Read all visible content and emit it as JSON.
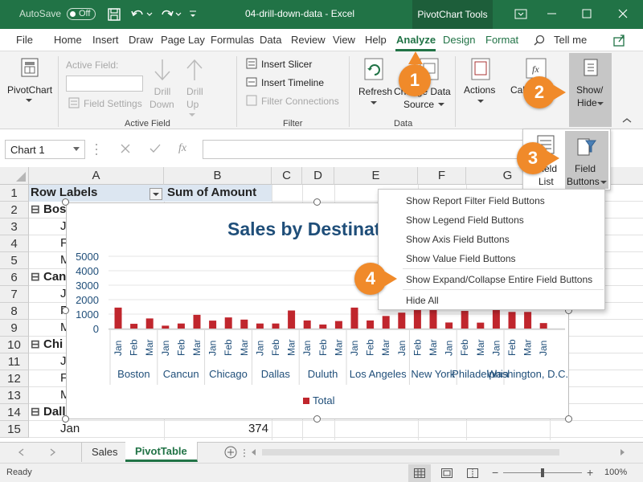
{
  "title_bar": {
    "autosave": "AutoSave",
    "autosave_state": "Off",
    "document_title": "04-drill-down-data  -  Excel",
    "context_tab": "PivotChart Tools"
  },
  "menu_tabs": [
    "File",
    "Home",
    "Insert",
    "Draw",
    "Page Lay",
    "Formulas",
    "Data",
    "Review",
    "View",
    "Help",
    "Analyze",
    "Design",
    "Format"
  ],
  "tell_me": "Tell me",
  "ribbon": {
    "pivotchart": "PivotChart",
    "active_field_label": "Active Field:",
    "field_settings": "Field Settings",
    "drill_down": [
      "Drill",
      "Down"
    ],
    "drill_up": [
      "Drill",
      "Up"
    ],
    "active_field_group": "Active Field",
    "insert_slicer": "Insert Slicer",
    "insert_timeline": "Insert Timeline",
    "filter_connections": "Filter Connections",
    "filter_group": "Filter",
    "refresh": "Refresh",
    "change_data_source": [
      "Change Data",
      "Source"
    ],
    "data_group": "Data",
    "actions": "Actions",
    "calc": "Calc",
    "show_hide": [
      "Show/",
      "Hide"
    ]
  },
  "formula_bar": {
    "name_box": "Chart 1",
    "fx": "fx"
  },
  "columns": [
    "A",
    "B",
    "C",
    "D",
    "E",
    "F",
    "G"
  ],
  "rows": [
    "1",
    "2",
    "3",
    "4",
    "5",
    "6",
    "7",
    "8",
    "9",
    "10",
    "11",
    "12",
    "13",
    "14",
    "15"
  ],
  "cells": {
    "a1": "Row Labels",
    "b1": "Sum of Amount",
    "a2": "Bos",
    "a3": "J",
    "a4": "F",
    "a5": "M",
    "a6": "Can",
    "a7": "J",
    "a8": "F",
    "a9": "M",
    "a10": "Chi",
    "a11": "J",
    "a12": "F",
    "a13": "M",
    "a14": "Dall",
    "a15": "Jan",
    "b15": "374",
    "collapse_symbol": "⊟"
  },
  "chart_data": {
    "type": "bar",
    "title": "Sales by Destinat",
    "ylim": [
      0,
      5000
    ],
    "yticks": [
      "5000",
      "4000",
      "3000",
      "2000",
      "1000",
      "0"
    ],
    "groups": [
      "Boston",
      "Cancun",
      "Chicago",
      "Dallas",
      "Duluth",
      "Los Angeles",
      "New York",
      "Philadelphia",
      "Washington, D.C."
    ],
    "months": [
      "Jan",
      "Feb",
      "Mar"
    ],
    "series": [
      {
        "name": "Total",
        "values": [
          1450,
          330,
          700,
          200,
          350,
          950,
          550,
          770,
          620,
          350,
          350,
          1250,
          560,
          280,
          520,
          1450,
          560,
          870,
          1100,
          1600,
          1450,
          420,
          1220,
          410,
          1300,
          1150,
          1150,
          380
        ]
      }
    ],
    "legend": "Total",
    "legend_position": "bottom",
    "bar_color": "#c0262d",
    "grid": true
  },
  "showhide_menu": {
    "field_list": [
      "Field",
      "List"
    ],
    "field_buttons": [
      "Field",
      "Buttons"
    ]
  },
  "field_buttons_menu": [
    "Show Report Filter Field Buttons",
    "Show Legend Field Buttons",
    "Show Axis Field Buttons",
    "Show Value Field Buttons",
    "Show Expand/Collapse Entire Field Buttons",
    "Hide All"
  ],
  "step_badges": [
    "1",
    "2",
    "3",
    "4"
  ],
  "sheet_tabs": [
    "Sales",
    "PivotTable"
  ],
  "status": {
    "ready": "Ready",
    "zoom": "100%",
    "minus": "−",
    "plus": "+"
  },
  "colors": {
    "excel_green": "#217346",
    "badge_orange": "#f08a2a",
    "pivot_header": "#dce6f1",
    "chart_title": "#1f4e79"
  }
}
